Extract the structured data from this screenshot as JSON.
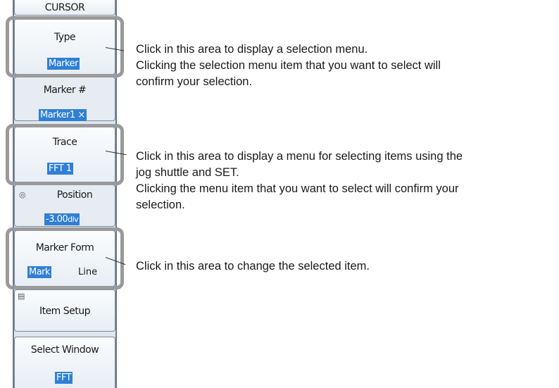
{
  "menu": {
    "title": "CURSOR",
    "type": {
      "label": "Type",
      "value": "Marker"
    },
    "marker_num": {
      "label": "Marker #",
      "value": "Marker1",
      "close": "×"
    },
    "trace": {
      "label": "Trace",
      "value": "FFT 1"
    },
    "position": {
      "label": "Position",
      "value_a": "-3.00",
      "value_b": "div"
    },
    "marker_form": {
      "label": "Marker Form",
      "option_mark": "Mark",
      "option_line": "Line"
    },
    "item_setup": {
      "label": "Item Setup"
    },
    "select_window": {
      "label": "Select Window",
      "value": "FFT"
    }
  },
  "callouts": {
    "selection_menu": [
      "Click in this area to display a selection menu.",
      "Clicking the selection menu item that you want to select will",
      "confirm your selection."
    ],
    "jog_menu": [
      "Click in this area to display a menu for selecting items using the",
      "jog shuttle and SET.",
      "Clicking the menu item that you want to select will confirm your",
      "selection."
    ],
    "toggle": [
      "Click in this area to change the selected item."
    ]
  },
  "colors": {
    "highlight": "#2f7fd6",
    "outline": "#9a9a9a"
  },
  "icons": {
    "jog": "jog-shuttle-icon",
    "setup": "item-setup-icon"
  }
}
